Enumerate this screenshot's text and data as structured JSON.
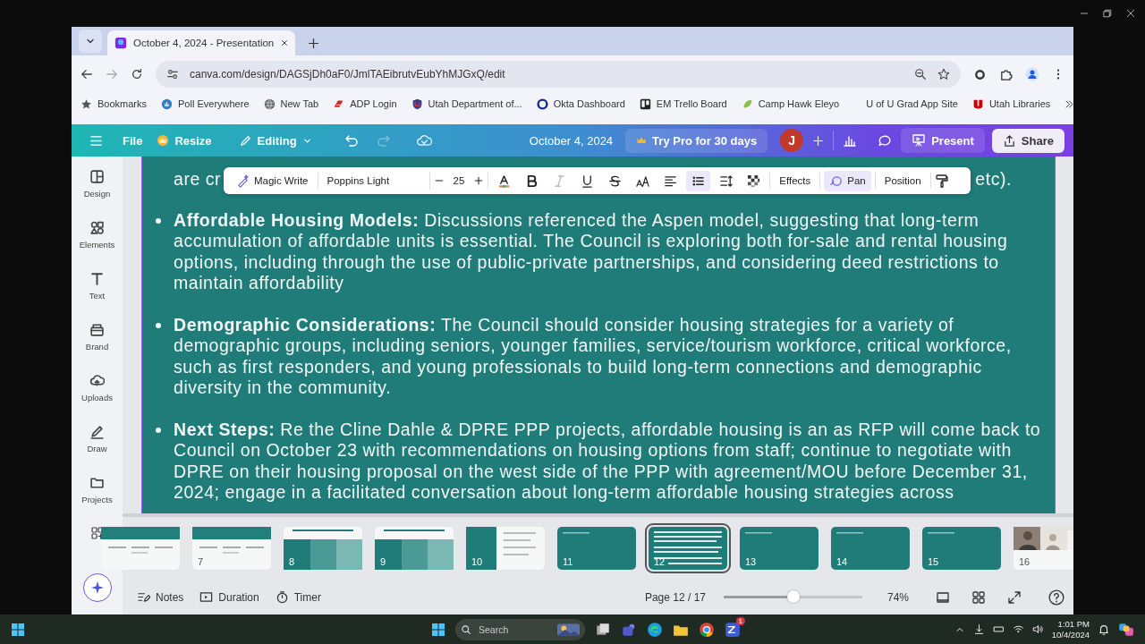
{
  "browser": {
    "tab": {
      "title": "October 4, 2024 - Presentation",
      "selected": true
    },
    "url": "canva.com/design/DAGSjDh0aF0/JmlTAEibrutvEubYhMJGxQ/edit",
    "bookmarks": [
      "Bookmarks",
      "Poll Everywhere",
      "New Tab",
      "ADP Login",
      "Utah Department of...",
      "Okta Dashboard",
      "EM Trello Board",
      "Camp Hawk Eleyo",
      "U of U Grad App Site",
      "Utah Libraries"
    ]
  },
  "editor": {
    "menu": [
      "File",
      "Resize"
    ],
    "mode": "Editing",
    "redo_disabled": true,
    "title": "October 4, 2024",
    "pro": "Try Pro for 30 days",
    "avatar": "J",
    "present": "Present",
    "share": "Share"
  },
  "sidebar": [
    "Design",
    "Elements",
    "Text",
    "Brand",
    "Uploads",
    "Draw",
    "Projects"
  ],
  "toolbar": {
    "magic": "Magic Write",
    "font": "Poppins Light",
    "size": "25",
    "tools": [
      {
        "kind": "color",
        "selected": false,
        "disabled": false
      },
      {
        "kind": "bold",
        "selected": false,
        "disabled": false
      },
      {
        "kind": "italic",
        "selected": false,
        "disabled": true
      },
      {
        "kind": "underline",
        "selected": false,
        "disabled": false
      },
      {
        "kind": "strike",
        "selected": false,
        "disabled": false
      },
      {
        "kind": "case",
        "selected": false,
        "disabled": false
      },
      {
        "kind": "align",
        "selected": false,
        "disabled": false
      },
      {
        "kind": "list",
        "selected": true,
        "disabled": false
      },
      {
        "kind": "spacing",
        "selected": false,
        "disabled": false
      },
      {
        "kind": "transparency",
        "selected": false,
        "disabled": false
      }
    ],
    "effects": "Effects",
    "pan": {
      "label": "Pan",
      "selected": true
    },
    "position": "Position"
  },
  "slide": {
    "fragments": [
      "are cr",
      "etc)."
    ],
    "bullets": [
      "**Affordable Housing Models:** Discussions referenced the Aspen model, suggesting that long-term accumulation of affordable units is essential. The Council is exploring both for-sale and rental housing options, including through the use of public-private partnerships, and considering deed restrictions to maintain affordability",
      "**Demographic Considerations:** The Council should consider housing strategies for a variety of demographic groups, including seniors, younger families, service/tourism workforce, critical workforce, such as first responders, and young professionals to build long-term connections and demographic diversity in the community.",
      "**Next Steps:** Re the Cline Dahle & DPRE PPP projects, affordable housing is an as RFP will come back to Council on October 23 with recommendations on housing options from staff; continue to negotiate with DPRE on their housing proposal on the west side of the PPP with agreement/MOU before December 31, 2024; engage in a facilitated conversation about long-term affordable housing strategies across"
    ]
  },
  "filmstrip": [
    {
      "kind": "light",
      "selected": false
    },
    {
      "kind": "light",
      "number": "7",
      "selected": false
    },
    {
      "kind": "columns",
      "number": "8",
      "selected": false
    },
    {
      "kind": "columns",
      "number": "9",
      "selected": false
    },
    {
      "kind": "split",
      "number": "10",
      "selected": false
    },
    {
      "kind": "teal",
      "number": "11",
      "selected": false
    },
    {
      "kind": "text",
      "number": "12",
      "selected": true
    },
    {
      "kind": "teal",
      "number": "13",
      "selected": false
    },
    {
      "kind": "teal",
      "number": "14",
      "selected": false
    },
    {
      "kind": "teal",
      "number": "15",
      "selected": false
    },
    {
      "number": "16",
      "selected": false
    }
  ],
  "footer": {
    "notes": "Notes",
    "duration": "Duration",
    "timer": "Timer",
    "page": "Page 12 / 17",
    "zoom": {
      "level": 0.5,
      "reading": "74%"
    }
  },
  "taskbar": {
    "search_placeholder": "Search",
    "badge": "1",
    "time": "1:01 PM",
    "date": "10/4/2024"
  }
}
